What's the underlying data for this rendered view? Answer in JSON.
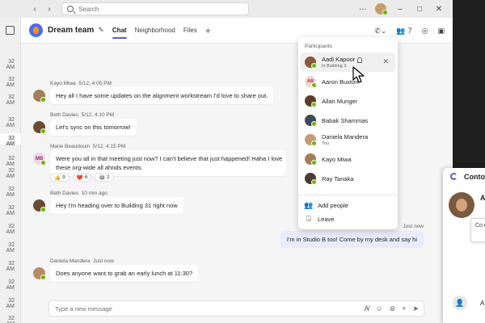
{
  "search": {
    "placeholder": "Search"
  },
  "left_strip": {
    "times": [
      "32 AM",
      "32 AM",
      "32 AM",
      "32 AM",
      "32 AM",
      "32 AM",
      "32 AM",
      "32 AM",
      "32 AM",
      "32 AM",
      "32 AM",
      "32 AM",
      "32 AM",
      "32 AM",
      "32 AM"
    ]
  },
  "header": {
    "title": "Dream team",
    "tabs": [
      {
        "label": "Chat"
      },
      {
        "label": "Neighborhood"
      },
      {
        "label": "Files"
      }
    ],
    "participant_count": "7"
  },
  "messages": [
    {
      "sender": "Kayo Miwa",
      "time": "5/12, 4:05 PM",
      "text": "Hey all I have some updates on the alignment workstream I'd love to share out."
    },
    {
      "sender": "Beth Davies",
      "time": "5/12, 4:10 PM",
      "text": "Let's sync on this tomorrow!"
    },
    {
      "sender": "Marie Beaudouin",
      "time": "5/12, 4:15 PM",
      "initials": "MB",
      "text_line1": "Were you all in that meeting just now? I can't believe that just happened! Haha I love",
      "text_line2": "these org-wide all ahnds events."
    },
    {
      "sender": "Beth Davies",
      "time": "10 min ago",
      "text": "Hey I'm heading over to Building 31 right now"
    },
    {
      "sender": "Daniela Mandera",
      "time": "Just now",
      "text": "Does anyone want to grab an early lunch at 11:30?"
    }
  ],
  "reactions": [
    {
      "emoji": "👍",
      "count": "9"
    },
    {
      "emoji": "❤️",
      "count": "6"
    },
    {
      "emoji": "😂",
      "count": "2"
    }
  ],
  "my_message": {
    "time": "Just now",
    "text": "I'm in Studio B too! Come by my desk and say hi"
  },
  "composer": {
    "placeholder": "Type a new message"
  },
  "participants": {
    "title": "Participants",
    "people": [
      {
        "name": "Aadi Kapoor",
        "sub": "In Building 3"
      },
      {
        "name": "Aaron Buxton",
        "sub": "",
        "initials": "AB"
      },
      {
        "name": "Allan Munger",
        "sub": ""
      },
      {
        "name": "Babak Shammas",
        "sub": ""
      },
      {
        "name": "Daniela Mandera",
        "sub": "You"
      },
      {
        "name": "Kayo Miwa",
        "sub": ""
      },
      {
        "name": "Ray Tanaka",
        "sub": ""
      }
    ],
    "actions": [
      {
        "label": "Add people"
      },
      {
        "label": "Leave"
      }
    ]
  },
  "contact_card": {
    "title": "Conto",
    "name_letter": "A",
    "tip_text": "Co net",
    "bottom_letter": "A"
  },
  "colors": {
    "accent": "#5b5fc7",
    "presence": "#6bb700",
    "my_bubble": "#e8ebfa"
  }
}
